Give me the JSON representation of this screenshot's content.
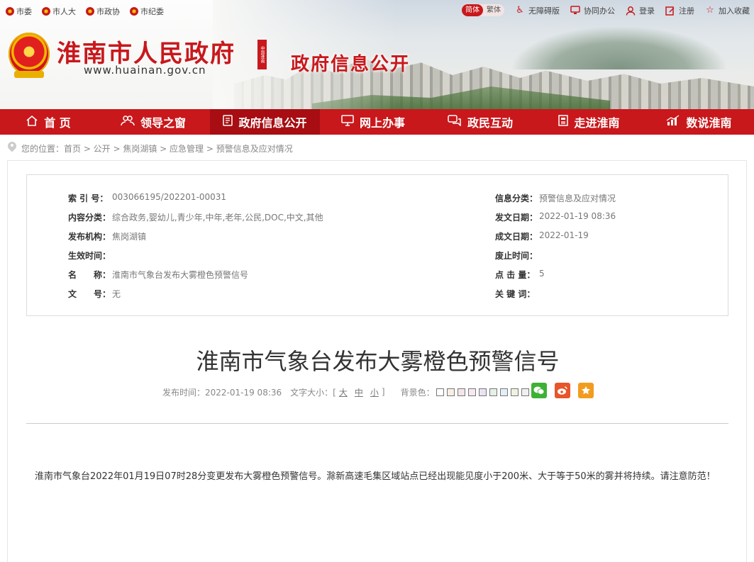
{
  "top_links": [
    "市委",
    "市人大",
    "市政协",
    "市纪委"
  ],
  "lang": {
    "simplified": "简体",
    "traditional": "繁体"
  },
  "top_right": [
    "无障碍版",
    "协同办公",
    "登录",
    "注册",
    "加入收藏"
  ],
  "site": {
    "name": "淮南市人民政府",
    "url": "www.huainan.gov.cn",
    "seal_text": "中国淮南",
    "section": "政府信息公开"
  },
  "nav": [
    {
      "label": "首 页",
      "icon": "home-icon",
      "active": false
    },
    {
      "label": "领导之窗",
      "icon": "people-icon",
      "active": false
    },
    {
      "label": "政府信息公开",
      "icon": "document-icon",
      "active": true
    },
    {
      "label": "网上办事",
      "icon": "monitor-icon",
      "active": false
    },
    {
      "label": "政民互动",
      "icon": "chat-icon",
      "active": false
    },
    {
      "label": "走进淮南",
      "icon": "book-icon",
      "active": false
    },
    {
      "label": "数说淮南",
      "icon": "chart-icon",
      "active": false
    }
  ],
  "breadcrumb": "您的位置：首页 > 公开 > 焦岗湖镇 > 应急管理 > 预警信息及应对情况",
  "meta": {
    "left": [
      {
        "k": "索 引 号：",
        "v": "003066195/202201-00031"
      },
      {
        "k": "内容分类：",
        "v": "综合政务,婴幼儿,青少年,中年,老年,公民,DOC,中文,其他"
      },
      {
        "k": "发布机构：",
        "v": "焦岗湖镇"
      },
      {
        "k": "生效时间：",
        "v": ""
      },
      {
        "k": "名　　称：",
        "v": "淮南市气象台发布大雾橙色预警信号"
      },
      {
        "k": "文　　号：",
        "v": "无"
      }
    ],
    "right": [
      {
        "k": "信息分类：",
        "v": "预警信息及应对情况"
      },
      {
        "k": "发文日期：",
        "v": "2022-01-19 08:36"
      },
      {
        "k": "成文日期：",
        "v": "2022-01-19"
      },
      {
        "k": "废止时间：",
        "v": ""
      },
      {
        "k": "点 击 量：",
        "v": "5"
      },
      {
        "k": "关 键 词：",
        "v": ""
      }
    ]
  },
  "article": {
    "title": "淮南市气象台发布大雾橙色预警信号",
    "publish_label": "发布时间：2022-01-19 08:36",
    "font_size_label": "文字大小：[",
    "font_sizes": [
      "大",
      "中",
      "小"
    ],
    "font_size_close": "]",
    "bg_label": "背景色：",
    "bg_colors": [
      "#ffffff",
      "#f7efe4",
      "#f3e5e8",
      "#f5e9f2",
      "#e9e3f1",
      "#e4f0e8",
      "#e3eef5",
      "#eef2e0",
      "#f0f0f0"
    ],
    "share": [
      {
        "icon": "wechat-icon",
        "color": "#3eb135"
      },
      {
        "icon": "weibo-icon",
        "color": "#e7552b"
      },
      {
        "icon": "favorite-icon",
        "color": "#f29c1f"
      }
    ],
    "body": "淮南市气象台2022年01月19日07时28分变更发布大雾橙色预警信号。滁新高速毛集区域站点已经出现能见度小于200米、大于等于50米的雾并将持续。请注意防范！"
  }
}
